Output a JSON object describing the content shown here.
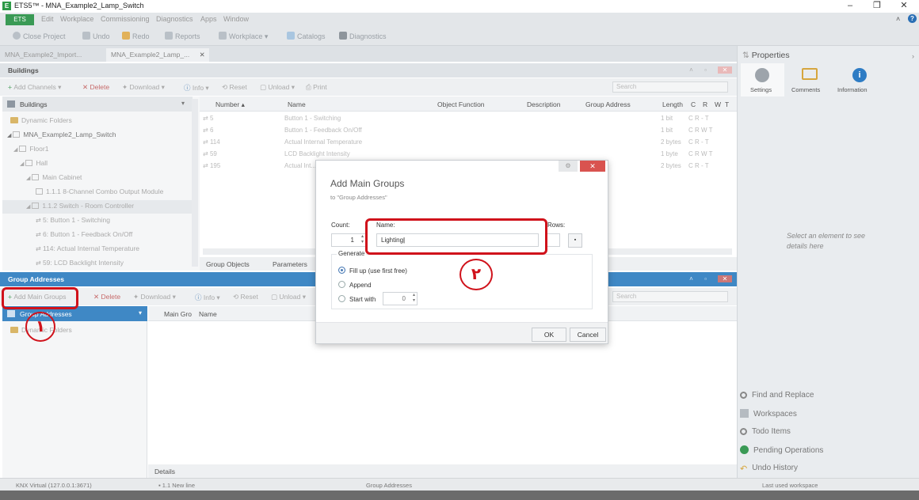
{
  "window": {
    "title": "ETS5™ - MNA_Example2_Lamp_Switch",
    "app_icon": "E"
  },
  "menu": {
    "ets_tab": "ETS",
    "items": [
      "Edit",
      "Workplace",
      "Commissioning",
      "Diagnostics",
      "Apps",
      "Window"
    ]
  },
  "toolbar": {
    "items": [
      "Close Project",
      "Undo",
      "Redo",
      "Reports",
      "Workplace ▾",
      "Catalogs",
      "Diagnostics"
    ]
  },
  "doc_tabs": [
    "MNA_Example2_Import...",
    "MNA_Example2_Lamp_..."
  ],
  "buildings": {
    "header": "Buildings",
    "toolbar": {
      "add_channels": "Add Channels ▾",
      "delete": "Delete",
      "download": "Download ▾",
      "info": "Info ▾",
      "reset": "Reset",
      "unload": "Unload ▾",
      "print": "Print",
      "search_placeholder": "Search"
    },
    "tree_header": "Buildings",
    "tree": [
      "Dynamic Folders",
      "MNA_Example2_Lamp_Switch",
      "Floor1",
      "Hall",
      "Main Cabinet",
      "1.1.1 8-Channel Combo Output Module",
      "1.1.2 Switch - Room Controller",
      "5: Button 1 - Switching",
      "6: Button 1 - Feedback On/Off",
      "114: Actual Internal Temperature",
      "59: LCD Backlight Intensity"
    ],
    "grid_columns": [
      "Number ▴",
      "Name",
      "Object Function",
      "Description",
      "Group Address",
      "Length",
      "C",
      "R",
      "W",
      "T"
    ],
    "grid_rows": [
      {
        "num": "5",
        "name": "Button 1 - Switching",
        "len": "1 bit",
        "flags": "C  R  -  T"
      },
      {
        "num": "6",
        "name": "Button 1 - Feedback On/Off",
        "len": "1 bit",
        "flags": "C  R  W  T"
      },
      {
        "num": "114",
        "name": "Actual Internal Temperature",
        "len": "2 bytes",
        "flags": "C  R  -  T"
      },
      {
        "num": "59",
        "name": "LCD Backlight Intensity",
        "len": "1 byte",
        "flags": "C  R  W  T"
      },
      {
        "num": "195",
        "name": "Actual Int...",
        "len": "2 bytes",
        "flags": "C  R  -  T"
      }
    ],
    "bottom_tabs": [
      "Group Objects",
      "Parameters"
    ]
  },
  "group_addresses": {
    "header": "Group Addresses",
    "toolbar": {
      "add_main_groups": "Add Main Groups",
      "delete": "Delete",
      "download": "Download ▾",
      "info": "Info ▾",
      "reset": "Reset",
      "unload": "Unload ▾",
      "search_placeholder": "Search"
    },
    "tree_header": "Group Addresses",
    "tree": [
      "Dynamic Folders"
    ],
    "grid_columns": [
      "Main Gro",
      "Name"
    ],
    "details_tab": "Details"
  },
  "properties": {
    "title": "Properties",
    "tabs": [
      "Settings",
      "Comments",
      "Information"
    ],
    "empty_text": "Select an element to see details here",
    "dock_items": [
      "Find and Replace",
      "Workspaces",
      "Todo Items",
      "Pending Operations",
      "Undo History"
    ]
  },
  "dialog": {
    "title": "Add Main Groups",
    "subtitle": "to \"Group Addresses\"",
    "count_label": "Count:",
    "count_value": "1",
    "name_label": "Name:",
    "name_value": "Lighting",
    "rows_label": "Rows:",
    "generate_label": "Generate",
    "options": [
      "Fill up (use first free)",
      "Append",
      "Start with"
    ],
    "selected_option": 0,
    "start_with_value": "0",
    "ok": "OK",
    "cancel": "Cancel"
  },
  "status": {
    "connection": "KNX Virtual  (127.0.0.1:3671)",
    "line": "1.1 New line",
    "center": "Group Addresses",
    "workspace": "Last used workspace"
  },
  "annotations": {
    "step1": "١",
    "step2": "٢"
  },
  "colors": {
    "accent_green": "#3a9a55",
    "panel_blue": "#3f88c5",
    "annotation_red": "#d0121b",
    "close_red": "#d9534f"
  }
}
